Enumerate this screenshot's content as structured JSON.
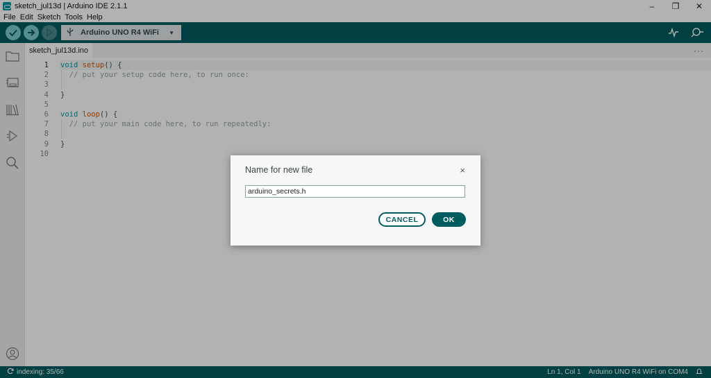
{
  "window": {
    "title": "sketch_jul13d | Arduino IDE 2.1.1",
    "minimize": "–",
    "restore": "❐",
    "close": "✕"
  },
  "menu": [
    "File",
    "Edit",
    "Sketch",
    "Tools",
    "Help"
  ],
  "toolbar": {
    "board": "Arduino UNO R4 WiFi",
    "accent_color": "#005c5f"
  },
  "sidebar": {
    "icons": [
      "folder-icon",
      "board-manager-icon",
      "library-icon",
      "debug-icon",
      "search-icon",
      "account-icon"
    ]
  },
  "editor": {
    "tab": "sketch_jul13d.ino",
    "tabs_more": "···",
    "line_numbers": [
      "1",
      "2",
      "3",
      "4",
      "5",
      "6",
      "7",
      "8",
      "9",
      "10"
    ],
    "lines": [
      {
        "t": [
          [
            "kw",
            "void"
          ],
          [
            "",
            " "
          ],
          [
            "fn",
            "setup"
          ],
          [
            "",
            "() {"
          ]
        ]
      },
      {
        "t": [
          [
            "",
            "  "
          ],
          [
            "cm",
            "// put your setup code here, to run once:"
          ]
        ]
      },
      {
        "t": [
          [
            "",
            ""
          ]
        ]
      },
      {
        "t": [
          [
            "",
            "}"
          ]
        ]
      },
      {
        "t": [
          [
            "",
            ""
          ]
        ]
      },
      {
        "t": [
          [
            "kw",
            "void"
          ],
          [
            "",
            " "
          ],
          [
            "fn",
            "loop"
          ],
          [
            "",
            "() {"
          ]
        ]
      },
      {
        "t": [
          [
            "",
            "  "
          ],
          [
            "cm",
            "// put your main code here, to run repeatedly:"
          ]
        ]
      },
      {
        "t": [
          [
            "",
            ""
          ]
        ]
      },
      {
        "t": [
          [
            "",
            "}"
          ]
        ]
      },
      {
        "t": [
          [
            "",
            ""
          ]
        ]
      }
    ]
  },
  "status": {
    "indexing": "indexing: 35/66",
    "position": "Ln 1, Col 1",
    "board_port": "Arduino UNO R4 WiFi on COM4"
  },
  "dialog": {
    "title": "Name for new file",
    "close": "×",
    "input_value": "arduino_secrets.h",
    "cancel_label": "CANCEL",
    "ok_label": "OK"
  }
}
